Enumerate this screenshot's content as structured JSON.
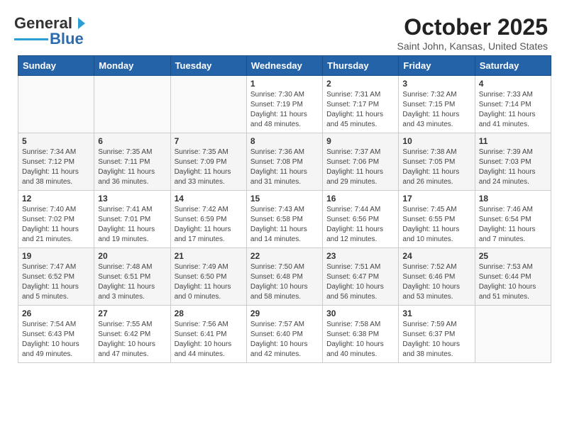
{
  "header": {
    "logo_general": "General",
    "logo_blue": "Blue",
    "title": "October 2025",
    "subtitle": "Saint John, Kansas, United States"
  },
  "weekdays": [
    "Sunday",
    "Monday",
    "Tuesday",
    "Wednesday",
    "Thursday",
    "Friday",
    "Saturday"
  ],
  "weeks": [
    [
      {
        "day": "",
        "sunrise": "",
        "sunset": "",
        "daylight": ""
      },
      {
        "day": "",
        "sunrise": "",
        "sunset": "",
        "daylight": ""
      },
      {
        "day": "",
        "sunrise": "",
        "sunset": "",
        "daylight": ""
      },
      {
        "day": "1",
        "sunrise": "Sunrise: 7:30 AM",
        "sunset": "Sunset: 7:19 PM",
        "daylight": "Daylight: 11 hours and 48 minutes."
      },
      {
        "day": "2",
        "sunrise": "Sunrise: 7:31 AM",
        "sunset": "Sunset: 7:17 PM",
        "daylight": "Daylight: 11 hours and 45 minutes."
      },
      {
        "day": "3",
        "sunrise": "Sunrise: 7:32 AM",
        "sunset": "Sunset: 7:15 PM",
        "daylight": "Daylight: 11 hours and 43 minutes."
      },
      {
        "day": "4",
        "sunrise": "Sunrise: 7:33 AM",
        "sunset": "Sunset: 7:14 PM",
        "daylight": "Daylight: 11 hours and 41 minutes."
      }
    ],
    [
      {
        "day": "5",
        "sunrise": "Sunrise: 7:34 AM",
        "sunset": "Sunset: 7:12 PM",
        "daylight": "Daylight: 11 hours and 38 minutes."
      },
      {
        "day": "6",
        "sunrise": "Sunrise: 7:35 AM",
        "sunset": "Sunset: 7:11 PM",
        "daylight": "Daylight: 11 hours and 36 minutes."
      },
      {
        "day": "7",
        "sunrise": "Sunrise: 7:35 AM",
        "sunset": "Sunset: 7:09 PM",
        "daylight": "Daylight: 11 hours and 33 minutes."
      },
      {
        "day": "8",
        "sunrise": "Sunrise: 7:36 AM",
        "sunset": "Sunset: 7:08 PM",
        "daylight": "Daylight: 11 hours and 31 minutes."
      },
      {
        "day": "9",
        "sunrise": "Sunrise: 7:37 AM",
        "sunset": "Sunset: 7:06 PM",
        "daylight": "Daylight: 11 hours and 29 minutes."
      },
      {
        "day": "10",
        "sunrise": "Sunrise: 7:38 AM",
        "sunset": "Sunset: 7:05 PM",
        "daylight": "Daylight: 11 hours and 26 minutes."
      },
      {
        "day": "11",
        "sunrise": "Sunrise: 7:39 AM",
        "sunset": "Sunset: 7:03 PM",
        "daylight": "Daylight: 11 hours and 24 minutes."
      }
    ],
    [
      {
        "day": "12",
        "sunrise": "Sunrise: 7:40 AM",
        "sunset": "Sunset: 7:02 PM",
        "daylight": "Daylight: 11 hours and 21 minutes."
      },
      {
        "day": "13",
        "sunrise": "Sunrise: 7:41 AM",
        "sunset": "Sunset: 7:01 PM",
        "daylight": "Daylight: 11 hours and 19 minutes."
      },
      {
        "day": "14",
        "sunrise": "Sunrise: 7:42 AM",
        "sunset": "Sunset: 6:59 PM",
        "daylight": "Daylight: 11 hours and 17 minutes."
      },
      {
        "day": "15",
        "sunrise": "Sunrise: 7:43 AM",
        "sunset": "Sunset: 6:58 PM",
        "daylight": "Daylight: 11 hours and 14 minutes."
      },
      {
        "day": "16",
        "sunrise": "Sunrise: 7:44 AM",
        "sunset": "Sunset: 6:56 PM",
        "daylight": "Daylight: 11 hours and 12 minutes."
      },
      {
        "day": "17",
        "sunrise": "Sunrise: 7:45 AM",
        "sunset": "Sunset: 6:55 PM",
        "daylight": "Daylight: 11 hours and 10 minutes."
      },
      {
        "day": "18",
        "sunrise": "Sunrise: 7:46 AM",
        "sunset": "Sunset: 6:54 PM",
        "daylight": "Daylight: 11 hours and 7 minutes."
      }
    ],
    [
      {
        "day": "19",
        "sunrise": "Sunrise: 7:47 AM",
        "sunset": "Sunset: 6:52 PM",
        "daylight": "Daylight: 11 hours and 5 minutes."
      },
      {
        "day": "20",
        "sunrise": "Sunrise: 7:48 AM",
        "sunset": "Sunset: 6:51 PM",
        "daylight": "Daylight: 11 hours and 3 minutes."
      },
      {
        "day": "21",
        "sunrise": "Sunrise: 7:49 AM",
        "sunset": "Sunset: 6:50 PM",
        "daylight": "Daylight: 11 hours and 0 minutes."
      },
      {
        "day": "22",
        "sunrise": "Sunrise: 7:50 AM",
        "sunset": "Sunset: 6:48 PM",
        "daylight": "Daylight: 10 hours and 58 minutes."
      },
      {
        "day": "23",
        "sunrise": "Sunrise: 7:51 AM",
        "sunset": "Sunset: 6:47 PM",
        "daylight": "Daylight: 10 hours and 56 minutes."
      },
      {
        "day": "24",
        "sunrise": "Sunrise: 7:52 AM",
        "sunset": "Sunset: 6:46 PM",
        "daylight": "Daylight: 10 hours and 53 minutes."
      },
      {
        "day": "25",
        "sunrise": "Sunrise: 7:53 AM",
        "sunset": "Sunset: 6:44 PM",
        "daylight": "Daylight: 10 hours and 51 minutes."
      }
    ],
    [
      {
        "day": "26",
        "sunrise": "Sunrise: 7:54 AM",
        "sunset": "Sunset: 6:43 PM",
        "daylight": "Daylight: 10 hours and 49 minutes."
      },
      {
        "day": "27",
        "sunrise": "Sunrise: 7:55 AM",
        "sunset": "Sunset: 6:42 PM",
        "daylight": "Daylight: 10 hours and 47 minutes."
      },
      {
        "day": "28",
        "sunrise": "Sunrise: 7:56 AM",
        "sunset": "Sunset: 6:41 PM",
        "daylight": "Daylight: 10 hours and 44 minutes."
      },
      {
        "day": "29",
        "sunrise": "Sunrise: 7:57 AM",
        "sunset": "Sunset: 6:40 PM",
        "daylight": "Daylight: 10 hours and 42 minutes."
      },
      {
        "day": "30",
        "sunrise": "Sunrise: 7:58 AM",
        "sunset": "Sunset: 6:38 PM",
        "daylight": "Daylight: 10 hours and 40 minutes."
      },
      {
        "day": "31",
        "sunrise": "Sunrise: 7:59 AM",
        "sunset": "Sunset: 6:37 PM",
        "daylight": "Daylight: 10 hours and 38 minutes."
      },
      {
        "day": "",
        "sunrise": "",
        "sunset": "",
        "daylight": ""
      }
    ]
  ]
}
